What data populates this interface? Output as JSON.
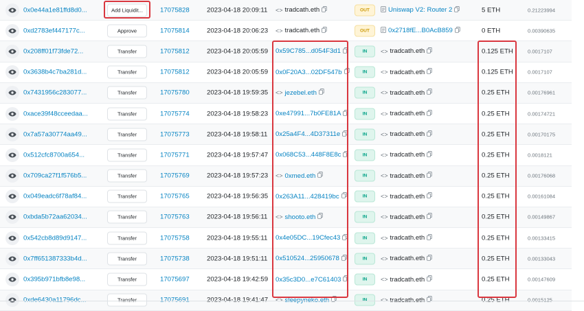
{
  "transactions": [
    {
      "hash": "0x0e44a1e81ffd8d0...",
      "method": "Add Liquidit...",
      "block": "17075828",
      "age": "2023-04-18 20:09:11",
      "from": "tradcath.eth",
      "from_icon": "ens-icon",
      "direction": "OUT",
      "to": "Uniswap V2: Router 2",
      "to_icon": "contract-icon",
      "value": "5 ETH",
      "fee": "0.21223994"
    },
    {
      "hash": "0xd2783ef447177c...",
      "method": "Approve",
      "block": "17075814",
      "age": "2023-04-18 20:06:23",
      "from": "tradcath.eth",
      "from_icon": "ens-icon",
      "direction": "OUT",
      "to": "0x2718fE...B0AcB859",
      "to_icon": "contract-icon",
      "value": "0 ETH",
      "fee": "0.00390635"
    },
    {
      "hash": "0x208ff01f73fde72...",
      "method": "Transfer",
      "block": "17075812",
      "age": "2023-04-18 20:05:59",
      "from": "0x59C785...d054F3d1",
      "from_icon": "",
      "direction": "IN",
      "to": "tradcath.eth",
      "to_icon": "ens-icon",
      "value": "0.125 ETH",
      "fee": "0.0017107"
    },
    {
      "hash": "0x3638b4c7ba281d...",
      "method": "Transfer",
      "block": "17075812",
      "age": "2023-04-18 20:05:59",
      "from": "0x0F20A3...02DF547b",
      "from_icon": "",
      "direction": "IN",
      "to": "tradcath.eth",
      "to_icon": "ens-icon",
      "value": "0.125 ETH",
      "fee": "0.0017107"
    },
    {
      "hash": "0x7431956c283077...",
      "method": "Transfer",
      "block": "17075780",
      "age": "2023-04-18 19:59:35",
      "from": "jezebel.eth",
      "from_icon": "ens-icon",
      "direction": "IN",
      "to": "tradcath.eth",
      "to_icon": "ens-icon",
      "value": "0.25 ETH",
      "fee": "0.00176961"
    },
    {
      "hash": "0xace39f48cceedaa...",
      "method": "Transfer",
      "block": "17075774",
      "age": "2023-04-18 19:58:23",
      "from": "0xe47991...7b0FE81A",
      "from_icon": "",
      "direction": "IN",
      "to": "tradcath.eth",
      "to_icon": "ens-icon",
      "value": "0.25 ETH",
      "fee": "0.00174721"
    },
    {
      "hash": "0x7a57a30774aa49...",
      "method": "Transfer",
      "block": "17075773",
      "age": "2023-04-18 19:58:11",
      "from": "0x25a4F4...4D37311e",
      "from_icon": "",
      "direction": "IN",
      "to": "tradcath.eth",
      "to_icon": "ens-icon",
      "value": "0.25 ETH",
      "fee": "0.00170175"
    },
    {
      "hash": "0x512cfc8700a654...",
      "method": "Transfer",
      "block": "17075771",
      "age": "2023-04-18 19:57:47",
      "from": "0x068C53...448F8E8c",
      "from_icon": "",
      "direction": "IN",
      "to": "tradcath.eth",
      "to_icon": "ens-icon",
      "value": "0.25 ETH",
      "fee": "0.0018121"
    },
    {
      "hash": "0x709ca27f1f576b5...",
      "method": "Transfer",
      "block": "17075769",
      "age": "2023-04-18 19:57:23",
      "from": "0xmed.eth",
      "from_icon": "ens-icon",
      "direction": "IN",
      "to": "tradcath.eth",
      "to_icon": "ens-icon",
      "value": "0.25 ETH",
      "fee": "0.00176068"
    },
    {
      "hash": "0x049eadc6f78af84...",
      "method": "Transfer",
      "block": "17075765",
      "age": "2023-04-18 19:56:35",
      "from": "0x263A11...428419bc",
      "from_icon": "",
      "direction": "IN",
      "to": "tradcath.eth",
      "to_icon": "ens-icon",
      "value": "0.25 ETH",
      "fee": "0.00161084"
    },
    {
      "hash": "0xbda5b72aa62034...",
      "method": "Transfer",
      "block": "17075763",
      "age": "2023-04-18 19:56:11",
      "from": "shooto.eth",
      "from_icon": "ens-icon",
      "direction": "IN",
      "to": "tradcath.eth",
      "to_icon": "ens-icon",
      "value": "0.25 ETH",
      "fee": "0.00149867"
    },
    {
      "hash": "0x542cb8d89d9147...",
      "method": "Transfer",
      "block": "17075758",
      "age": "2023-04-18 19:55:11",
      "from": "0x4e05DC...19Cfec43",
      "from_icon": "",
      "direction": "IN",
      "to": "tradcath.eth",
      "to_icon": "ens-icon",
      "value": "0.25 ETH",
      "fee": "0.00133415"
    },
    {
      "hash": "0x7ff651387333b4d...",
      "method": "Transfer",
      "block": "17075738",
      "age": "2023-04-18 19:51:11",
      "from": "0x510524...25950678",
      "from_icon": "",
      "direction": "IN",
      "to": "tradcath.eth",
      "to_icon": "ens-icon",
      "value": "0.25 ETH",
      "fee": "0.00133043"
    },
    {
      "hash": "0x395b971bfb8e98...",
      "method": "Transfer",
      "block": "17075697",
      "age": "2023-04-18 19:42:59",
      "from": "0x35c3D0...e7C61403",
      "from_icon": "",
      "direction": "IN",
      "to": "tradcath.eth",
      "to_icon": "ens-icon",
      "value": "0.25 ETH",
      "fee": "0.00147609"
    },
    {
      "hash": "0xde6430a11796dc...",
      "method": "Transfer",
      "block": "17075691",
      "age": "2023-04-18 19:41:47",
      "from": "sleepyneko.eth",
      "from_icon": "ens-icon",
      "direction": "IN",
      "to": "tradcath.eth",
      "to_icon": "ens-icon",
      "value": "0.25 ETH",
      "fee": "0.0015125"
    }
  ],
  "highlights": {
    "color": "#d9363e",
    "boxes": [
      "method-first-row",
      "from-column-transfers",
      "value-column-transfers"
    ]
  },
  "colors": {
    "link": "#0784c3",
    "out_badge": "#cc9a06",
    "in_badge": "#00a186",
    "highlight": "#d9363e"
  }
}
